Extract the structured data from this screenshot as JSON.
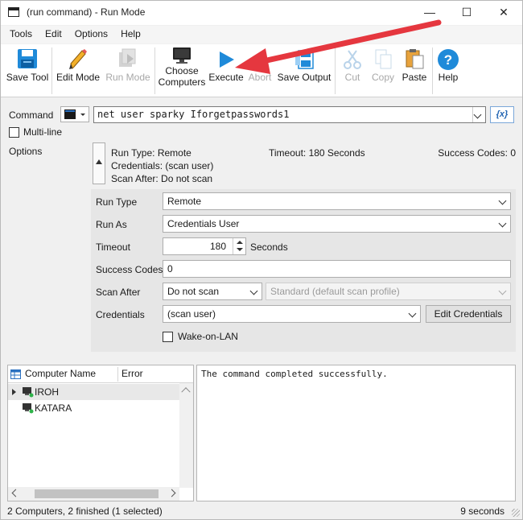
{
  "window": {
    "title": "(run command) - Run Mode",
    "controls": {
      "minimize": "—",
      "maximize": "☐",
      "close": "✕"
    }
  },
  "menu": [
    "Tools",
    "Edit",
    "Options",
    "Help"
  ],
  "toolbar": {
    "save_tool": "Save Tool",
    "edit_mode": "Edit Mode",
    "run_mode": "Run Mode",
    "choose_computers_line1": "Choose",
    "choose_computers_line2": "Computers",
    "execute": "Execute",
    "abort": "Abort",
    "save_output": "Save Output",
    "cut": "Cut",
    "copy": "Copy",
    "paste": "Paste",
    "help": "Help"
  },
  "command": {
    "label": "Command",
    "value": "net user sparky Iforgetpasswords1",
    "variables_button": "{x}",
    "multiline_label": "Multi-line",
    "multiline_checked": false
  },
  "options": {
    "label": "Options",
    "summary": {
      "run_type": "Run Type: Remote",
      "timeout": "Timeout: 180 Seconds",
      "success_codes": "Success Codes: 0",
      "credentials": "Credentials: (scan user)",
      "scan_after": "Scan After: Do not scan"
    },
    "run_type": {
      "label": "Run Type",
      "value": "Remote"
    },
    "run_as": {
      "label": "Run As",
      "value": "Credentials User"
    },
    "timeout": {
      "label": "Timeout",
      "value": "180",
      "unit": "Seconds"
    },
    "success_codes": {
      "label": "Success Codes",
      "value": "0"
    },
    "scan_after": {
      "label": "Scan After",
      "value": "Do not scan",
      "profile": "Standard (default scan profile)"
    },
    "credentials": {
      "label": "Credentials",
      "value": "(scan user)",
      "edit_button": "Edit Credentials"
    },
    "wake_on_lan": {
      "label": "Wake-on-LAN",
      "checked": false
    }
  },
  "computers": {
    "columns": [
      "Computer Name",
      "Error"
    ],
    "rows": [
      {
        "name": "IROH",
        "error": "",
        "selected": true
      },
      {
        "name": "KATARA",
        "error": "",
        "selected": false
      }
    ]
  },
  "output": "The command completed successfully.",
  "status": {
    "left": "2 Computers, 2 finished (1 selected)",
    "right": "9 seconds"
  },
  "colors": {
    "accent_blue": "#1f8ad9",
    "annotation_arrow": "#e5373f",
    "disabled_text": "#a8a8a8"
  }
}
